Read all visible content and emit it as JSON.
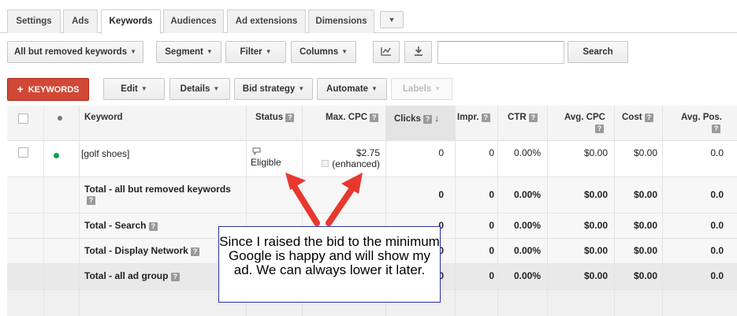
{
  "tabs": [
    {
      "label": "Settings"
    },
    {
      "label": "Ads"
    },
    {
      "label": "Keywords"
    },
    {
      "label": "Audiences"
    },
    {
      "label": "Ad extensions"
    },
    {
      "label": "Dimensions"
    }
  ],
  "toolbar1": {
    "view_filter": "All but removed keywords",
    "segment": "Segment",
    "filter": "Filter",
    "columns": "Columns",
    "chart_icon": "chart-icon",
    "download_icon": "download-icon",
    "search_value": "",
    "search_button": "Search"
  },
  "toolbar2": {
    "add_keywords": "KEYWORDS",
    "edit": "Edit",
    "details": "Details",
    "bid_strategy": "Bid strategy",
    "automate": "Automate",
    "labels": "Labels"
  },
  "table": {
    "headers": {
      "keyword": "Keyword",
      "status": "Status",
      "max_cpc": "Max. CPC",
      "clicks": "Clicks",
      "impr": "Impr.",
      "ctr": "CTR",
      "avg_cpc": "Avg. CPC",
      "cost": "Cost",
      "avg_pos": "Avg. Pos."
    },
    "rows": [
      {
        "keyword": "[golf shoes]",
        "status": "Eligible",
        "max_cpc": "$2.75",
        "max_cpc_note": "(enhanced)",
        "clicks": "0",
        "impr": "0",
        "ctr": "0.00%",
        "avg_cpc": "$0.00",
        "cost": "$0.00",
        "avg_pos": "0.0"
      }
    ],
    "totals": [
      {
        "label": "Total - all but removed keywords",
        "clicks": "0",
        "impr": "0",
        "ctr": "0.00%",
        "avg_cpc": "$0.00",
        "cost": "$0.00",
        "avg_pos": "0.0"
      },
      {
        "label": "Total - Search",
        "clicks": "0",
        "impr": "0",
        "ctr": "0.00%",
        "avg_cpc": "$0.00",
        "cost": "$0.00",
        "avg_pos": "0.0"
      },
      {
        "label": "Total - Display Network",
        "clicks": "0",
        "impr": "0",
        "ctr": "0.00%",
        "avg_cpc": "$0.00",
        "cost": "$0.00",
        "avg_pos": "0.0"
      },
      {
        "label": "Total - all ad group",
        "clicks": "0",
        "impr": "0",
        "ctr": "0.00%",
        "avg_cpc": "$0.00",
        "cost": "$0.00",
        "avg_pos": "0.0"
      }
    ]
  },
  "annotation": {
    "text": "Since I raised the bid to the minimum Google is happy and will show my ad.  We can always lower it later.",
    "arrow_color": "#e8382e"
  },
  "colors": {
    "accent_red": "#d14836",
    "status_dot": "#0f9d58",
    "callout_border": "#2b2ba8"
  }
}
